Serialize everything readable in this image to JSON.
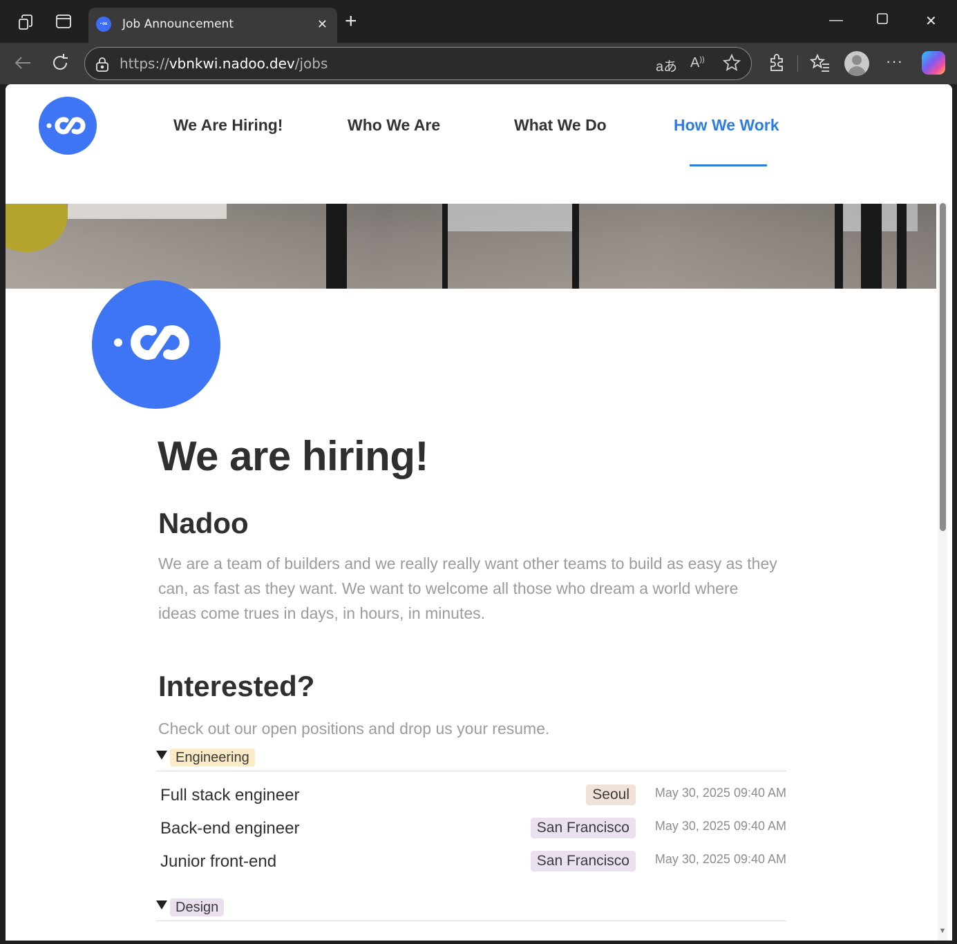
{
  "browser": {
    "tab_title": "Job Announcement",
    "tab_favicon_text": "·∞",
    "url_scheme": "https://",
    "url_host": "vbnkwi.nadoo.dev",
    "url_path": "/jobs",
    "new_tab_symbol": "+",
    "close_tab_symbol": "✕",
    "minimize_symbol": "—",
    "maximize_symbol": "☐",
    "close_window_symbol": "✕",
    "more_symbol": "···"
  },
  "site": {
    "nav": [
      {
        "label": "We Are Hiring!"
      },
      {
        "label": "Who We Are"
      },
      {
        "label": "What We Do"
      },
      {
        "label": "How We Work",
        "active": true
      }
    ],
    "brand_color": "#3e75f4",
    "active_color": "#2d7de0"
  },
  "page": {
    "title": "We are hiring!",
    "company_heading": "Nadoo",
    "company_description": "We are a team of builders and we really really want other teams to build as easy as they can, as fast as they want. We want to welcome all those who dream a world where ideas come trues in days, in hours, in minutes.",
    "cta_heading": "Interested?",
    "cta_text": "Check out our open positions and drop us your resume.",
    "groups": [
      {
        "name": "Engineering",
        "tag_color": "#fbecc7",
        "jobs": [
          {
            "title": "Full stack engineer",
            "location": "Seoul",
            "location_color": "#f1e2d9",
            "date": "May 30, 2025 09:40 AM"
          },
          {
            "title": "Back-end engineer",
            "location": "San Francisco",
            "location_color": "#ebe0ef",
            "date": "May 30, 2025 09:40 AM"
          },
          {
            "title": "Junior front-end",
            "location": "San Francisco",
            "location_color": "#ebe0ef",
            "date": "May 30, 2025 09:40 AM"
          }
        ]
      },
      {
        "name": "Design",
        "tag_color": "#ebe0ef",
        "jobs": []
      }
    ]
  }
}
